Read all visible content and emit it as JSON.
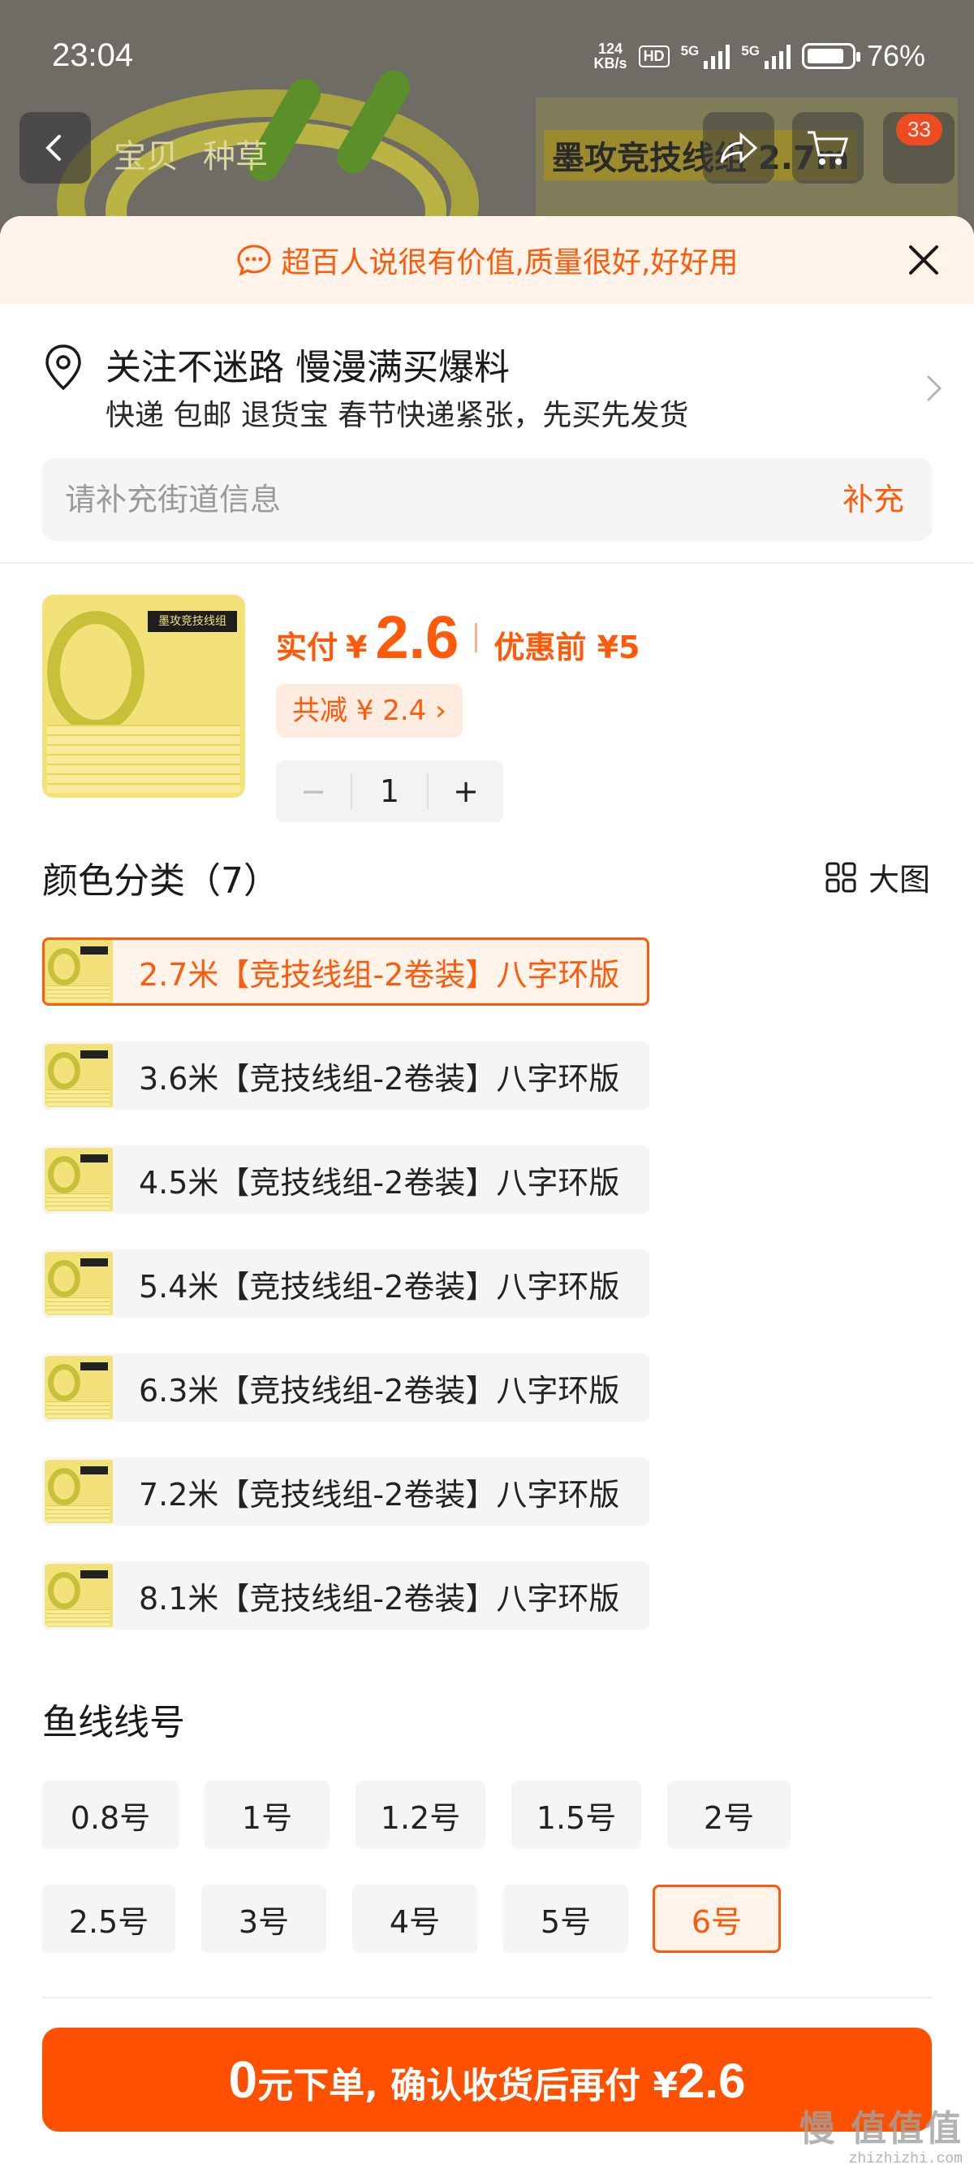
{
  "status_bar": {
    "time": "23:04",
    "net_speed_value": "124",
    "net_speed_unit": "KB/s",
    "hd_label": "HD",
    "signal1_label": "5G",
    "signal2_label": "5G",
    "battery_percent": "76%"
  },
  "background": {
    "tabs": [
      "宝贝",
      "种草"
    ],
    "banner_title": "墨攻竞技线组 2.7m",
    "cart_badge": "33"
  },
  "notice": {
    "text": "超百人说很有价值,质量很好,好好用"
  },
  "address": {
    "title": "关注不迷路 慢漫满买爆料",
    "subtitle": "快递 包邮 退货宝 春节快递紧张，先买先发货",
    "street_placeholder": "请补充街道信息",
    "street_button": "补充"
  },
  "product": {
    "image_label": "墨攻竞技线组 2.7m",
    "price_label": "实付",
    "currency": "¥",
    "price": "2.6",
    "original_price_text": "优惠前 ¥5",
    "discount_text": "共减 ¥ 2.4 ›",
    "quantity": "1",
    "minus_label": "−",
    "plus_label": "+"
  },
  "color_section": {
    "title": "颜色分类（7）",
    "big_view_label": "大图",
    "options": [
      {
        "label": "2.7米【竞技线组-2卷装】八字环版",
        "selected": true
      },
      {
        "label": "3.6米【竞技线组-2卷装】八字环版",
        "selected": false
      },
      {
        "label": "4.5米【竞技线组-2卷装】八字环版",
        "selected": false
      },
      {
        "label": "5.4米【竞技线组-2卷装】八字环版",
        "selected": false
      },
      {
        "label": "6.3米【竞技线组-2卷装】八字环版",
        "selected": false
      },
      {
        "label": "7.2米【竞技线组-2卷装】八字环版",
        "selected": false
      },
      {
        "label": "8.1米【竞技线组-2卷装】八字环版",
        "selected": false
      }
    ]
  },
  "line_section": {
    "title": "鱼线线号",
    "sizes": [
      {
        "label": "0.8号",
        "selected": false
      },
      {
        "label": "1号",
        "selected": false
      },
      {
        "label": "1.2号",
        "selected": false
      },
      {
        "label": "1.5号",
        "selected": false
      },
      {
        "label": "2号",
        "selected": false
      },
      {
        "label": "2.5号",
        "selected": false
      },
      {
        "label": "3号",
        "selected": false
      },
      {
        "label": "4号",
        "selected": false
      },
      {
        "label": "5号",
        "selected": false
      },
      {
        "label": "6号",
        "selected": true
      }
    ]
  },
  "cta": {
    "zero": "0",
    "text": "元下单, 确认收货后再付 ¥",
    "amount": "2.6"
  },
  "watermark": {
    "main": "慢 值值值",
    "sub": "zhizhizhi.com"
  },
  "colors": {
    "accent": "#ff5a0a",
    "cta": "#ff5000",
    "notice_bg": "#fff3ea",
    "option_bg": "#f5f5f5"
  }
}
